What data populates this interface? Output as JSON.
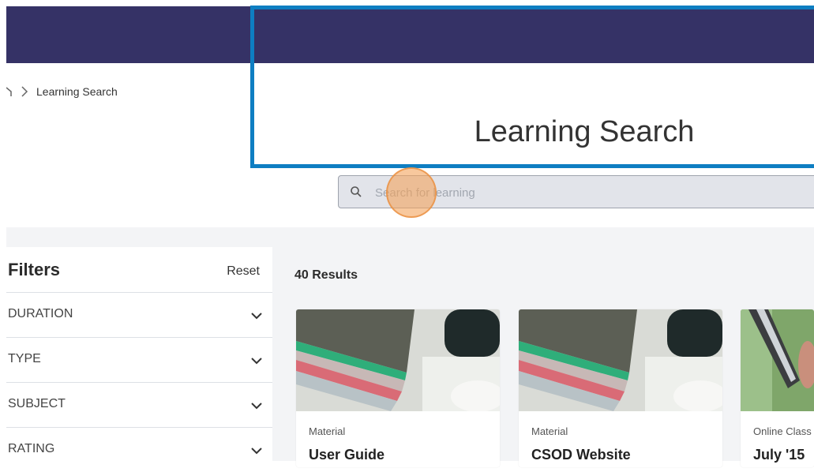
{
  "breadcrumb": {
    "current": "Learning Search"
  },
  "page": {
    "title": "Learning Search"
  },
  "search": {
    "placeholder": "Search for learning",
    "value": ""
  },
  "filters": {
    "title": "Filters",
    "reset_label": "Reset",
    "sections": [
      {
        "label": "DURATION"
      },
      {
        "label": "TYPE"
      },
      {
        "label": "SUBJECT"
      },
      {
        "label": "RATING"
      }
    ]
  },
  "results": {
    "count_label": "40 Results"
  },
  "cards": [
    {
      "type": "Material",
      "title": "User Guide"
    },
    {
      "type": "Material",
      "title": "CSOD Website"
    },
    {
      "type": "Online Class",
      "title": "July '15"
    }
  ],
  "colors": {
    "header": "#353266",
    "highlight": "#0e7ec2",
    "page_bg": "#f3f4f6",
    "click_marker": "#f4a45c"
  }
}
